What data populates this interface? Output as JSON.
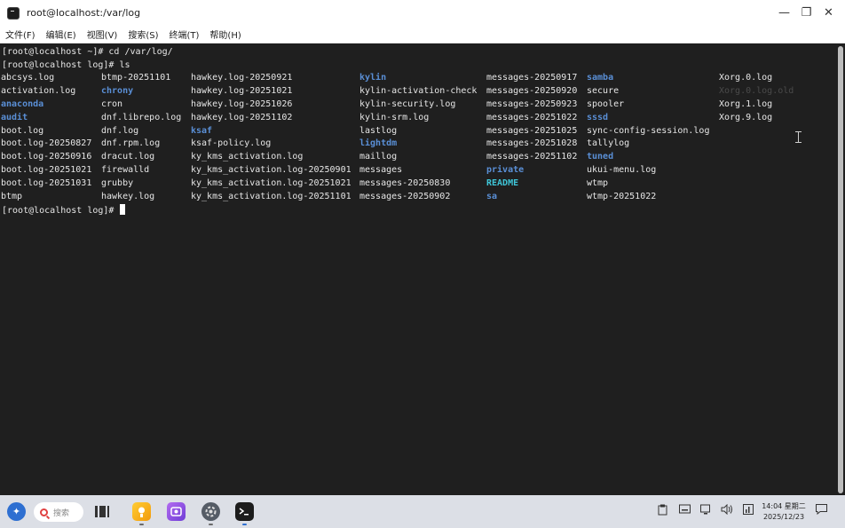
{
  "window": {
    "title": "root@localhost:/var/log",
    "controls": {
      "minimize": "—",
      "restore": "❐",
      "close": "✕"
    }
  },
  "menu": [
    "文件(F)",
    "编辑(E)",
    "视图(V)",
    "搜索(S)",
    "终端(T)",
    "帮助(H)"
  ],
  "terminal": {
    "line1": "[root@localhost ~]# cd /var/log/",
    "line2": "[root@localhost log]# ls",
    "prompt": "[root@localhost log]# ",
    "ls_columns": [
      [
        {
          "name": "abcsys.log",
          "type": "file"
        },
        {
          "name": "activation.log",
          "type": "file"
        },
        {
          "name": "anaconda",
          "type": "dir"
        },
        {
          "name": "audit",
          "type": "dir"
        },
        {
          "name": "boot.log",
          "type": "file"
        },
        {
          "name": "boot.log-20250827",
          "type": "file"
        },
        {
          "name": "boot.log-20250916",
          "type": "file"
        },
        {
          "name": "boot.log-20251021",
          "type": "file"
        },
        {
          "name": "boot.log-20251031",
          "type": "file"
        },
        {
          "name": "btmp",
          "type": "file"
        }
      ],
      [
        {
          "name": "btmp-20251101",
          "type": "file"
        },
        {
          "name": "chrony",
          "type": "dir"
        },
        {
          "name": "cron",
          "type": "file"
        },
        {
          "name": "dnf.librepo.log",
          "type": "file"
        },
        {
          "name": "dnf.log",
          "type": "file"
        },
        {
          "name": "dnf.rpm.log",
          "type": "file"
        },
        {
          "name": "dracut.log",
          "type": "file"
        },
        {
          "name": "firewalld",
          "type": "file"
        },
        {
          "name": "grubby",
          "type": "file"
        },
        {
          "name": "hawkey.log",
          "type": "file"
        }
      ],
      [
        {
          "name": "hawkey.log-20250921",
          "type": "file"
        },
        {
          "name": "hawkey.log-20251021",
          "type": "file"
        },
        {
          "name": "hawkey.log-20251026",
          "type": "file"
        },
        {
          "name": "hawkey.log-20251102",
          "type": "file"
        },
        {
          "name": "ksaf",
          "type": "dir"
        },
        {
          "name": "ksaf-policy.log",
          "type": "file"
        },
        {
          "name": "ky_kms_activation.log",
          "type": "file"
        },
        {
          "name": "ky_kms_activation.log-20250901",
          "type": "file"
        },
        {
          "name": "ky_kms_activation.log-20251021",
          "type": "file"
        },
        {
          "name": "ky_kms_activation.log-20251101",
          "type": "file"
        }
      ],
      [
        {
          "name": "kylin",
          "type": "dir"
        },
        {
          "name": "kylin-activation-check",
          "type": "file"
        },
        {
          "name": "kylin-security.log",
          "type": "file"
        },
        {
          "name": "kylin-srm.log",
          "type": "file"
        },
        {
          "name": "lastlog",
          "type": "file"
        },
        {
          "name": "lightdm",
          "type": "dir"
        },
        {
          "name": "maillog",
          "type": "file"
        },
        {
          "name": "messages",
          "type": "file"
        },
        {
          "name": "messages-20250830",
          "type": "file"
        },
        {
          "name": "messages-20250902",
          "type": "file"
        }
      ],
      [
        {
          "name": "messages-20250917",
          "type": "file"
        },
        {
          "name": "messages-20250920",
          "type": "file"
        },
        {
          "name": "messages-20250923",
          "type": "file"
        },
        {
          "name": "messages-20251022",
          "type": "file"
        },
        {
          "name": "messages-20251025",
          "type": "file"
        },
        {
          "name": "messages-20251028",
          "type": "file"
        },
        {
          "name": "messages-20251102",
          "type": "file"
        },
        {
          "name": "private",
          "type": "dir"
        },
        {
          "name": "README",
          "type": "cyan"
        },
        {
          "name": "sa",
          "type": "dir"
        }
      ],
      [
        {
          "name": "samba",
          "type": "dir"
        },
        {
          "name": "secure",
          "type": "file"
        },
        {
          "name": "spooler",
          "type": "file"
        },
        {
          "name": "sssd",
          "type": "dir"
        },
        {
          "name": "sync-config-session.log",
          "type": "file"
        },
        {
          "name": "tallylog",
          "type": "file"
        },
        {
          "name": "tuned",
          "type": "dir"
        },
        {
          "name": "ukui-menu.log",
          "type": "file"
        },
        {
          "name": "wtmp",
          "type": "file"
        },
        {
          "name": "wtmp-20251022",
          "type": "file"
        }
      ],
      [
        {
          "name": "Xorg.0.log",
          "type": "file"
        },
        {
          "name": "Xorg.0.log.old",
          "type": "dim"
        },
        {
          "name": "Xorg.1.log",
          "type": "file"
        },
        {
          "name": "Xorg.9.log",
          "type": "file"
        }
      ]
    ]
  },
  "taskbar": {
    "search_placeholder": "搜索",
    "apps": [
      "kylin-start-icon",
      "multitask-view-icon",
      "file-manager-icon",
      "app-store-icon",
      "settings-icon",
      "terminal-icon"
    ],
    "time": "14:04 星期二",
    "date": "2025/12/23"
  },
  "colors": {
    "terminal_bg": "#1f1f1f",
    "terminal_fg": "#e6e6e6",
    "dir": "#5a8fd6",
    "cyan": "#3fc6d9",
    "taskbar_bg": "#dcdfe6"
  }
}
